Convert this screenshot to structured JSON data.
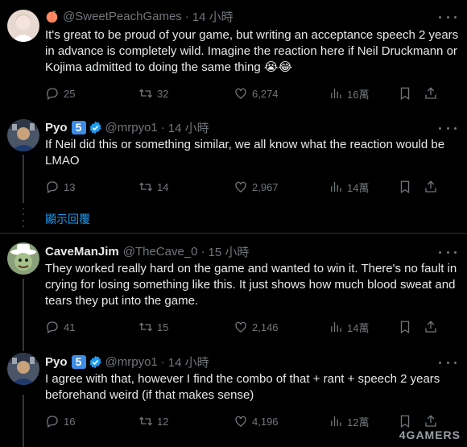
{
  "tweets": [
    {
      "name": "",
      "handle": "@SweetPeachGames",
      "time": "14 小時",
      "text": "It's great to be proud of your game, but writing an acceptance speech 2 years in advance is completely wild. Imagine the reaction here if Neil Druckmann or Kojima admitted to doing the same thing 😭😂",
      "replies": "25",
      "retweets": "32",
      "likes": "6,274",
      "views": "16萬"
    },
    {
      "name": "Pyo",
      "badge": "5",
      "handle": "@mrpyo1",
      "time": "14 小時",
      "text": "If Neil did this or something similar, we all know what the reaction would be LMAO",
      "replies": "13",
      "retweets": "14",
      "likes": "2,967",
      "views": "14萬"
    },
    {
      "name": "CaveManJim",
      "handle": "@TheCave_0",
      "time": "15 小時",
      "text": "They worked really hard on the game and wanted to win it. There's no fault in crying for losing something like this. It just shows how much blood sweat and tears they put into the game.",
      "replies": "41",
      "retweets": "15",
      "likes": "2,146",
      "views": "14萬"
    },
    {
      "name": "Pyo",
      "badge": "5",
      "handle": "@mrpyo1",
      "time": "14 小時",
      "text": "I agree with that, however I find the combo of that + rant + speech 2 years beforehand weird (if that makes sense)",
      "replies": "16",
      "retweets": "12",
      "likes": "4,196",
      "views": "12萬"
    }
  ],
  "show_replies": "顯示回覆",
  "watermark": "4GAMERS",
  "colors": {
    "accent": "#1d9bf0",
    "muted": "#71767b",
    "text": "#e7e9ea",
    "background": "#000000"
  }
}
